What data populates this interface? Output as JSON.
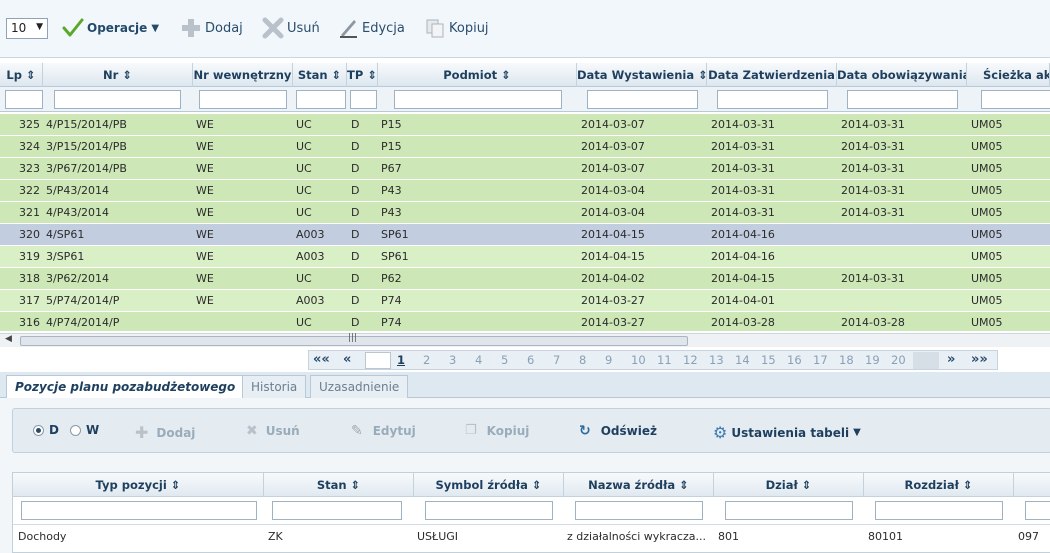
{
  "toolbar": {
    "page_size": "10",
    "operacje": "Operacje",
    "dodaj": "Dodaj",
    "usun": "Usuń",
    "edycja": "Edycja",
    "kopiuj": "Kopiuj"
  },
  "grid": {
    "columns": [
      "Lp",
      "Nr",
      "Nr wewnętrzny",
      "Stan",
      "TP",
      "Podmiot",
      "Data Wystawienia",
      "Data Zatwierdzenia",
      "Data obowiązywania",
      "Ścieżka ak"
    ],
    "rows": [
      {
        "lp": "325",
        "nr": "4/P15/2014/PB",
        "wew": "WE",
        "stan": "UC",
        "tp": "D",
        "podmiot": "P15",
        "wyst": "2014-03-07",
        "zatw": "2014-03-31",
        "obow": "2014-03-31",
        "sciezka": "UM05"
      },
      {
        "lp": "324",
        "nr": "3/P15/2014/PB",
        "wew": "WE",
        "stan": "UC",
        "tp": "D",
        "podmiot": "P15",
        "wyst": "2014-03-07",
        "zatw": "2014-03-31",
        "obow": "2014-03-31",
        "sciezka": "UM05"
      },
      {
        "lp": "323",
        "nr": "3/P67/2014/PB",
        "wew": "WE",
        "stan": "UC",
        "tp": "D",
        "podmiot": "P67",
        "wyst": "2014-03-07",
        "zatw": "2014-03-31",
        "obow": "2014-03-31",
        "sciezka": "UM05"
      },
      {
        "lp": "322",
        "nr": "5/P43/2014",
        "wew": "WE",
        "stan": "UC",
        "tp": "D",
        "podmiot": "P43",
        "wyst": "2014-03-04",
        "zatw": "2014-03-31",
        "obow": "2014-03-31",
        "sciezka": "UM05"
      },
      {
        "lp": "321",
        "nr": "4/P43/2014",
        "wew": "WE",
        "stan": "UC",
        "tp": "D",
        "podmiot": "P43",
        "wyst": "2014-03-04",
        "zatw": "2014-03-31",
        "obow": "2014-03-31",
        "sciezka": "UM05"
      },
      {
        "lp": "320",
        "nr": "4/SP61",
        "wew": "WE",
        "stan": "A003",
        "tp": "D",
        "podmiot": "SP61",
        "wyst": "2014-04-15",
        "zatw": "2014-04-16",
        "obow": "",
        "sciezka": "UM05"
      },
      {
        "lp": "319",
        "nr": "3/SP61",
        "wew": "WE",
        "stan": "A003",
        "tp": "D",
        "podmiot": "SP61",
        "wyst": "2014-04-15",
        "zatw": "2014-04-16",
        "obow": "",
        "sciezka": "UM05"
      },
      {
        "lp": "318",
        "nr": "3/P62/2014",
        "wew": "WE",
        "stan": "UC",
        "tp": "D",
        "podmiot": "P62",
        "wyst": "2014-04-02",
        "zatw": "2014-04-15",
        "obow": "2014-03-31",
        "sciezka": "UM05"
      },
      {
        "lp": "317",
        "nr": "5/P74/2014/P",
        "wew": "WE",
        "stan": "A003",
        "tp": "D",
        "podmiot": "P74",
        "wyst": "2014-03-27",
        "zatw": "2014-04-01",
        "obow": "",
        "sciezka": "UM05"
      },
      {
        "lp": "316",
        "nr": "4/P74/2014/P",
        "wew": "",
        "stan": "UC",
        "tp": "D",
        "podmiot": "P74",
        "wyst": "2014-03-27",
        "zatw": "2014-03-28",
        "obow": "2014-03-28",
        "sciezka": "UM05"
      }
    ]
  },
  "pager": {
    "first": "««",
    "prev": "«",
    "pages": [
      "1",
      "2",
      "3",
      "4",
      "5",
      "6",
      "7",
      "8",
      "9",
      "10",
      "11",
      "12",
      "13",
      "14",
      "15",
      "16",
      "17",
      "18",
      "19",
      "20"
    ],
    "current_page": "1",
    "next": "»",
    "last": "»»"
  },
  "tabs": [
    "Pozycje planu pozabudżetowego",
    "Historia",
    "Uzasadnienie"
  ],
  "panel2": {
    "radio_d": "D",
    "radio_w": "W",
    "dodaj": "Dodaj",
    "usun": "Usuń",
    "edytuj": "Edytuj",
    "kopiuj": "Kopiuj",
    "odswiez": "Odśwież",
    "ustawienia": "Ustawienia tabeli"
  },
  "grid2": {
    "columns": [
      "Typ pozycji",
      "Stan",
      "Symbol źródła",
      "Nazwa źródła",
      "Dział",
      "Rozdział"
    ],
    "row": {
      "typ": "Dochody",
      "stan": "ZK",
      "symbol": "USŁUGI",
      "nazwa": "z działalności wykracza...",
      "dzial": "801",
      "rozdzial": "80101",
      "extra": "097"
    }
  },
  "colors": {
    "row_green": "#cde8b6",
    "row_light_green": "#d9efc6",
    "row_selected": "#c3cde0",
    "header_text": "#1e3f5e"
  }
}
